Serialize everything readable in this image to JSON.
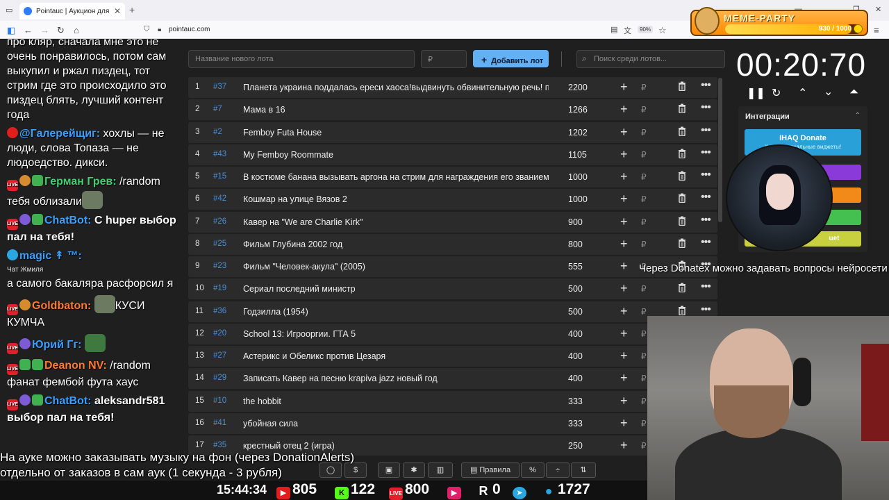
{
  "browser": {
    "tab_title": "Pointauc | Аукцион для стрима",
    "url": "pointauc.com",
    "zoom": "90%"
  },
  "meme_party": {
    "title": "MEME-PARTY",
    "progress": "930 / 1000",
    "progress_fraction": 0.93
  },
  "chat": {
    "messages": [
      {
        "name": "",
        "text": "про кляр, сначала мне это не очень понравилось, потом сам выкупил и ржал пиздец, тот стрим где это происходило это пиздец блять, лучший контент года"
      },
      {
        "name": "@Галерейщиг:",
        "text": " хохлы — не люди, слова Топаза — не людоедство. дикси."
      },
      {
        "name": "Герман Грев:",
        "text": " /random тебя облизали"
      },
      {
        "name": "ChatBot:",
        "text": "С huper выбор пал на тебя!"
      },
      {
        "name": "magic ↟ ™:",
        "text": ""
      },
      {
        "name": "",
        "text": "Чат Жмиля"
      },
      {
        "name": "",
        "text": "а самого бакаляра расфорсил я"
      },
      {
        "name": "Goldbaton:",
        "text": "КУСИ КУМЧА"
      },
      {
        "name": "Юрий Гг:",
        "text": ""
      },
      {
        "name": "Deanon NV:",
        "text": " /random фанат фембой фута хаус"
      },
      {
        "name": "ChatBot:",
        "text": " aleksandr581 выбор пал на тебя!"
      }
    ]
  },
  "auction": {
    "name_placeholder": "Название нового лота",
    "cost_placeholder": "₽",
    "add_label": "Добавить лот",
    "search_placeholder": "Поиск среди лотов...",
    "currency": "₽",
    "lots": [
      {
        "n": "1",
        "id": "#37",
        "name": "Планета украина поддалась ереси хаоса!выдвинуть обвинительную речь! пора",
        "amount": "2200"
      },
      {
        "n": "2",
        "id": "#7",
        "name": "Мама в 16",
        "amount": "1266"
      },
      {
        "n": "3",
        "id": "#2",
        "name": "Femboy Futa House",
        "amount": "1202"
      },
      {
        "n": "4",
        "id": "#43",
        "name": "My Femboy Roommate",
        "amount": "1105"
      },
      {
        "n": "5",
        "id": "#15",
        "name": "В костюме банана вызывать аргона на стрим для награждения его званием",
        "amount": "1000"
      },
      {
        "n": "6",
        "id": "#42",
        "name": "Кошмар на улице Вязов 2",
        "amount": "1000"
      },
      {
        "n": "7",
        "id": "#26",
        "name": "Кавер на \"We are Charlie Kirk\"",
        "amount": "900"
      },
      {
        "n": "8",
        "id": "#25",
        "name": "Фильм Глубина 2002 год",
        "amount": "800"
      },
      {
        "n": "9",
        "id": "#23",
        "name": "Фильм \"Человек-акула\" (2005)",
        "amount": "555"
      },
      {
        "n": "10",
        "id": "#19",
        "name": "Сериал последний министр",
        "amount": "500"
      },
      {
        "n": "11",
        "id": "#36",
        "name": "Годзилла (1954)",
        "amount": "500"
      },
      {
        "n": "12",
        "id": "#20",
        "name": "School 13: Игрооргии. ГТА 5",
        "amount": "400"
      },
      {
        "n": "13",
        "id": "#27",
        "name": "Астерикс и Обеликс против Цезаря",
        "amount": "400"
      },
      {
        "n": "14",
        "id": "#29",
        "name": "Записать Кавер на песню krapiva jazz новый год",
        "amount": "400"
      },
      {
        "n": "15",
        "id": "#10",
        "name": "the hobbit",
        "amount": "333"
      },
      {
        "n": "16",
        "id": "#41",
        "name": "убойная сила",
        "amount": "333"
      },
      {
        "n": "17",
        "id": "#35",
        "name": "крестный отец 2 (игра)",
        "amount": "250"
      }
    ]
  },
  "timer": {
    "value": "00:20:70"
  },
  "integrations": {
    "header": "Интеграции",
    "donate_title": "IHAQ Donate",
    "donate_sub": "Крутые уникальные виджеты!",
    "last_btn": "uet"
  },
  "captions": {
    "donatex": "Через Donatex можно задавать вопросы нейросети",
    "music1": "На ауке можно заказывать музыку на фон (через DonationAlerts)",
    "music2": "отдельно от заказов в сам аук (1 секунда - 3 рубля)"
  },
  "toolbar": {
    "rules": "Правила",
    "percent": "%"
  },
  "stats": {
    "time": "15:44:34",
    "youtube": "805",
    "kick": "122",
    "live": "800",
    "rutube": "0",
    "viewers": "1727"
  },
  "colors": {
    "accent": "#64b0f5",
    "id_blue": "#4a8ed6",
    "bg": "#1f1f1f",
    "row": "#2b2b2b"
  }
}
